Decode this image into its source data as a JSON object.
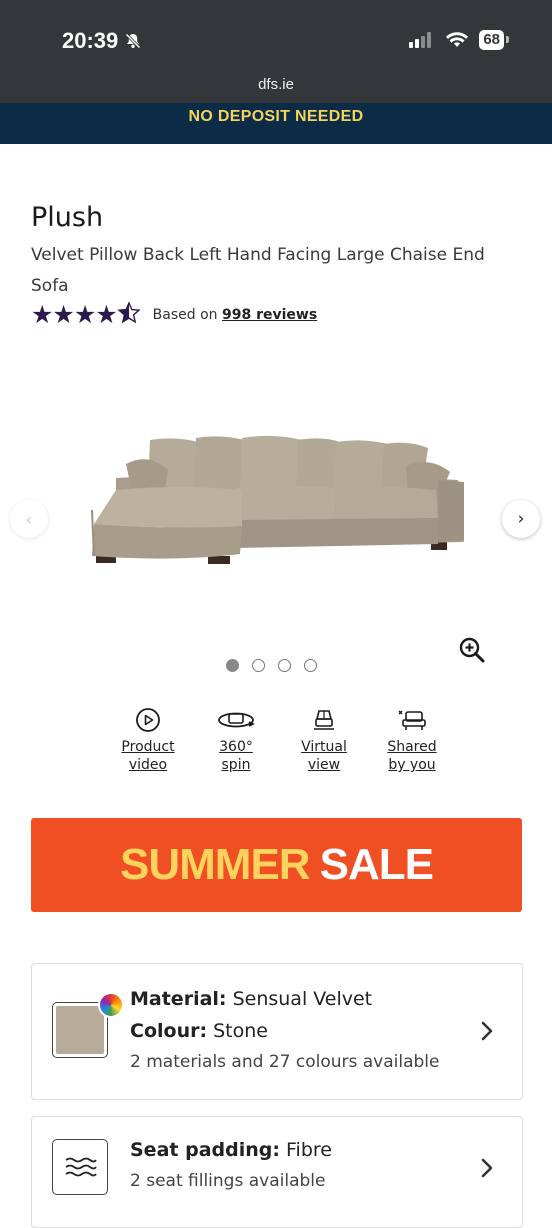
{
  "status_bar": {
    "time": "20:39",
    "battery": "68",
    "url": "dfs.ie"
  },
  "promo": {
    "text": "NO DEPOSIT NEEDED"
  },
  "product": {
    "brand": "Plush",
    "description": "Velvet Pillow Back Left Hand Facing Large Chaise End Sofa",
    "rating": 4.5,
    "rating_stars": "★★★★",
    "reviews_prefix": "Based on",
    "reviews_link": "998 reviews"
  },
  "carousel": {
    "prev_icon": "‹",
    "next_icon": "›",
    "slides": 4,
    "active_slide": 1
  },
  "media_links": [
    {
      "label_line1": "Product",
      "label_line2": "video",
      "icon": "play-icon"
    },
    {
      "label_line1": "360°",
      "label_line2": "spin",
      "icon": "rotate-360-icon"
    },
    {
      "label_line1": "Virtual",
      "label_line2": "view",
      "icon": "ar-view-icon"
    },
    {
      "label_line1": "Shared",
      "label_line2": "by you",
      "icon": "shared-photo-icon"
    }
  ],
  "sale_banner": {
    "word1": "SUMMER",
    "word2": "SALE",
    "bg_color": "#f04e23"
  },
  "material_card": {
    "material_label": "Material:",
    "material_value": "Sensual Velvet",
    "colour_label": "Colour:",
    "colour_value": "Stone",
    "availability": "2 materials and 27 colours available",
    "swatch_color": "#b7ab9a"
  },
  "padding_card": {
    "label": "Seat padding:",
    "value": "Fibre",
    "availability": "2 seat fillings available"
  },
  "colors": {
    "status_bar": "#34373a",
    "promo_bg": "#0b2b47",
    "promo_text": "#f3d35c",
    "stars": "#2b1a4a"
  }
}
